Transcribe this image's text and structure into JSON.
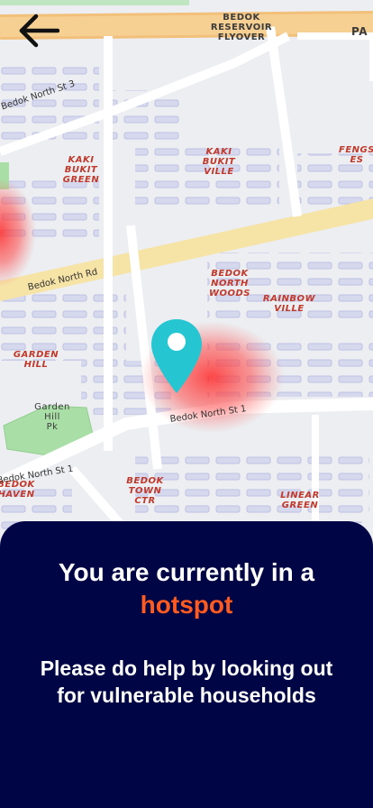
{
  "map": {
    "labels": {
      "bedok_reservoir_flyover": "BEDOK\nRESERVOIR\nFLYOVER",
      "pa": "PA",
      "kaki_bukit_green": "KAKI\nBUKIT\nGREEN",
      "kaki_bukit_ville": "KAKI\nBUKIT\nVILLE",
      "fengshan_estate": "FENGS\nES",
      "bedok_north_woods": "BEDOK\nNORTH\nWOODS",
      "rainbow_ville": "RAINBOW\nVILLE",
      "garden_hill": "GARDEN\nHILL",
      "garden_hill_park": "Garden\nHill\nPk",
      "bedok_haven": "BEDOK\nHAVEN",
      "bedok_town_ctr": "BEDOK\nTOWN\nCTR",
      "linear_green": "LINEAR\nGREEN"
    },
    "roads": {
      "bedok_north_st3": "Bedok North St 3",
      "bedok_north_rd": "Bedok North Rd",
      "bedok_north_st1_a": "Bedok North St 1",
      "bedok_north_st1_b": "Bedok North St 1"
    }
  },
  "sheet": {
    "title": "You are currently in a",
    "highlight": "hotspot",
    "message": "Please do help by looking out for vulnerable households"
  },
  "colors": {
    "sheet_bg": "#000645",
    "highlight": "#ff5a1f",
    "pin": "#25c6d2",
    "hotspot": "#ff3b3b"
  }
}
